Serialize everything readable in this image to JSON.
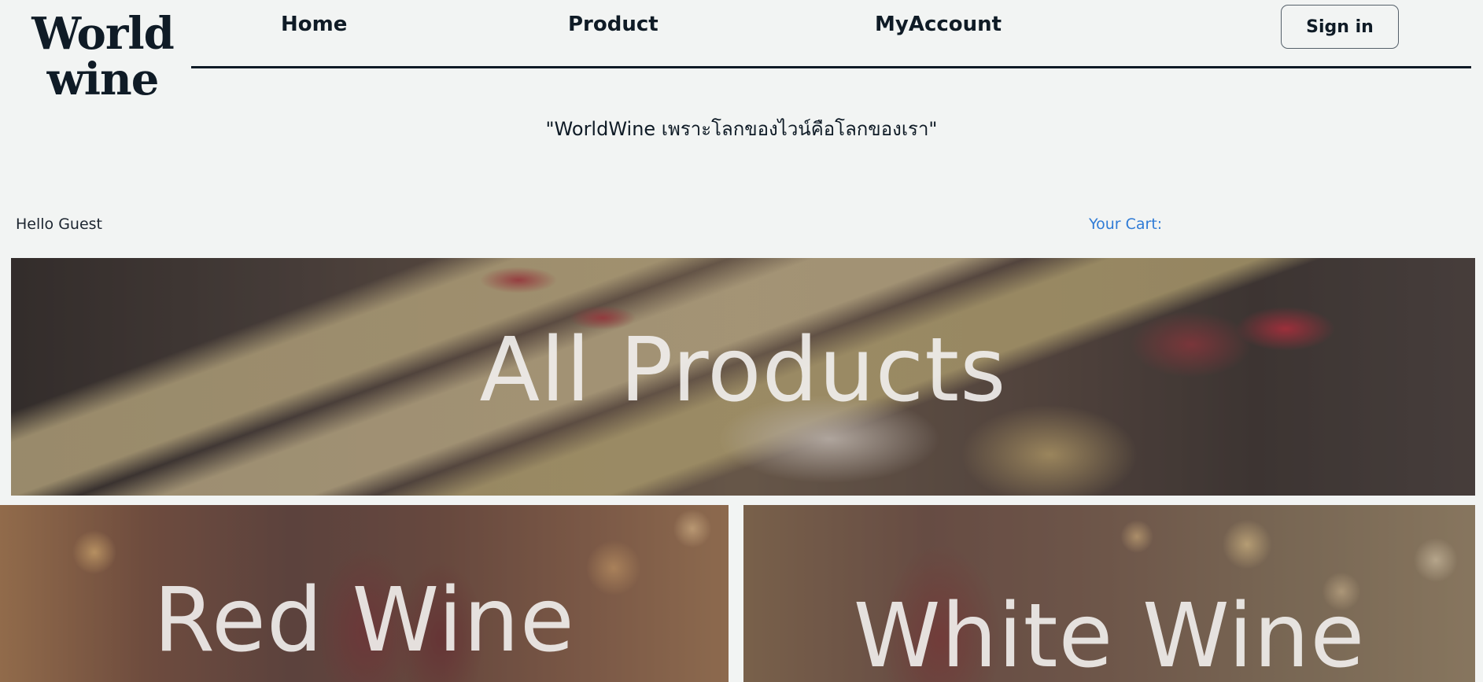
{
  "brand": {
    "line1": "World",
    "line2": "wine"
  },
  "nav": {
    "home": "Home",
    "product": "Product",
    "account": "MyAccount"
  },
  "auth": {
    "sign_in": "Sign in"
  },
  "slogan": "\"WorldWine เพราะโลกของไวน์คือโลกของเรา\"",
  "greeting": "Hello Guest",
  "cart": {
    "label": "Your Cart:"
  },
  "banners": {
    "all": "All Products",
    "red": "Red Wine",
    "white": "White Wine"
  }
}
